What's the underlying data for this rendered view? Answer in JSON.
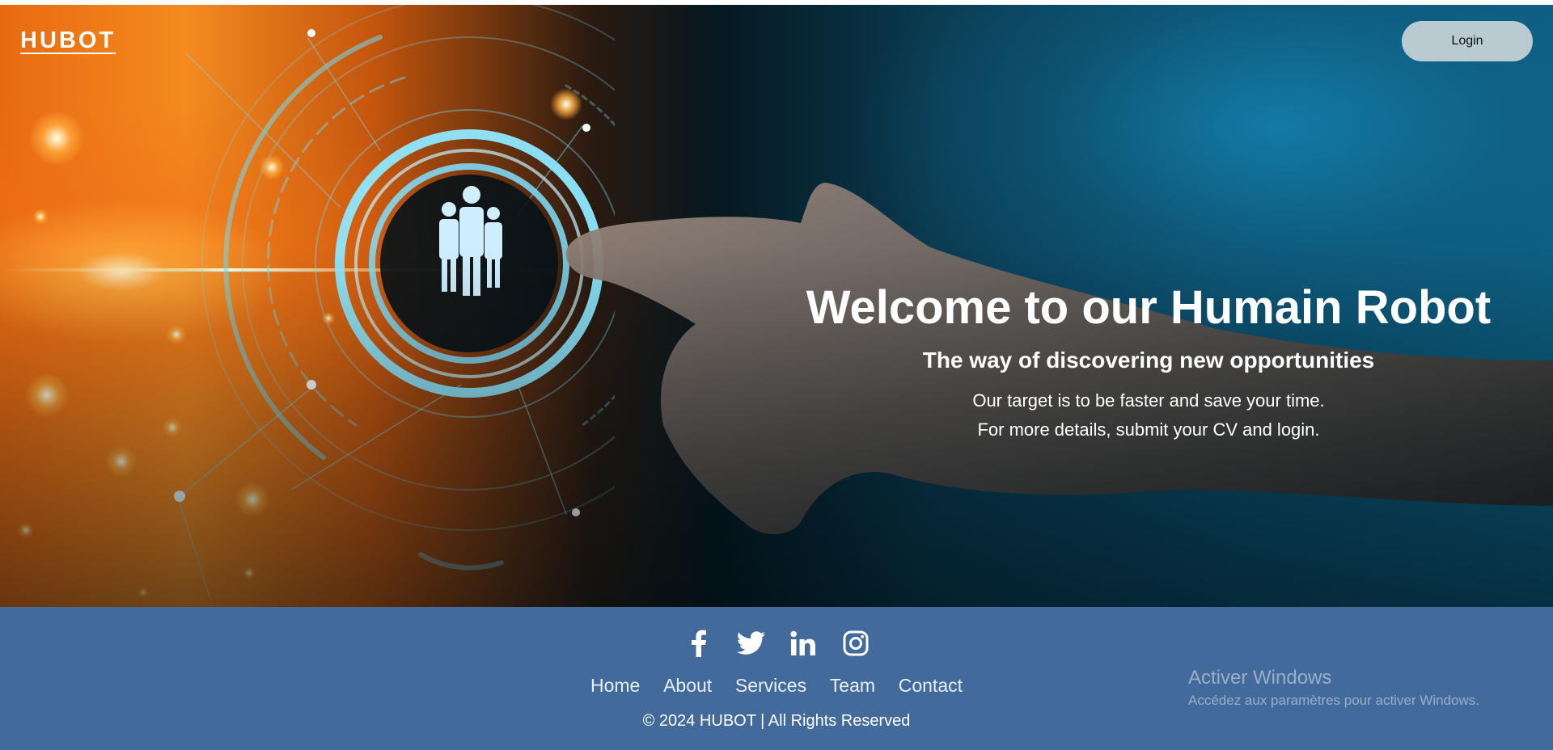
{
  "header": {
    "brand": "HUBOT",
    "login_label": "Login"
  },
  "hero": {
    "title": "Welcome to our Humain Robot",
    "subtitle": "The way of discovering new opportunities",
    "line1": "Our target is to be faster and save your time.",
    "line2": "For more details, submit your CV and login."
  },
  "footer": {
    "social": [
      {
        "icon": "facebook-icon"
      },
      {
        "icon": "twitter-icon"
      },
      {
        "icon": "linkedin-icon"
      },
      {
        "icon": "instagram-icon"
      }
    ],
    "nav": [
      "Home",
      "About",
      "Services",
      "Team",
      "Contact"
    ],
    "copyright": "© 2024 HUBOT | All Rights Reserved"
  },
  "watermark": {
    "title": "Activer Windows",
    "subtitle": "Accédez aux paramètres pour activer Windows."
  },
  "colors": {
    "footer_bg": "#426b9b",
    "login_bg": "#b9cad1",
    "accent_orange": "#f48a20",
    "accent_cyan": "#5fd3f0"
  }
}
